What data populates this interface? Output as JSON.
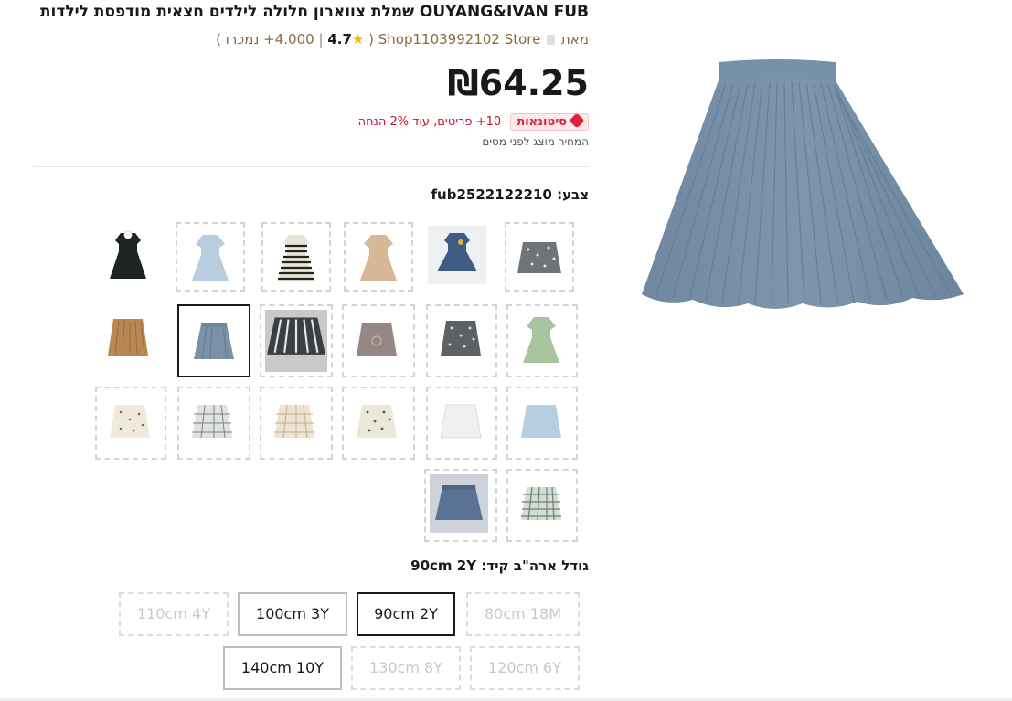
{
  "product": {
    "title": "OUYANG&IVAN FUB שמלת צווארון חלולה לילדים חצאית מודפסת לילדות",
    "store_prefix": "מאת",
    "store_name": "Shop1103992102 Store",
    "store_open": "(",
    "store_score": "4.000",
    "rating": "4.7",
    "sold": "+ נמכרו )",
    "price": "₪64.25",
    "wholesale_badge": "סיטונאות",
    "wholesale_text": "10+ פריטים, עוד 2% הנחה",
    "tax_note": "המחיר מוצג לפני מסים"
  },
  "color": {
    "label": "צבע: fub2522122210"
  },
  "size": {
    "label": "גודל ארה\"ב קיד: 90cm 2Y",
    "options": [
      "80cm 18M",
      "90cm 2Y",
      "100cm 3Y",
      "110cm 4Y",
      "120cm 6Y",
      "130cm 8Y",
      "140cm 10Y"
    ],
    "selected": "90cm 2Y",
    "unavailable": [
      "80cm 18M",
      "110cm 4Y",
      "120cm 6Y",
      "130cm 8Y"
    ]
  },
  "colors": {
    "main_skirt": "#7790a8",
    "promo_red": "#e0213d",
    "selected_border": "#191919"
  }
}
